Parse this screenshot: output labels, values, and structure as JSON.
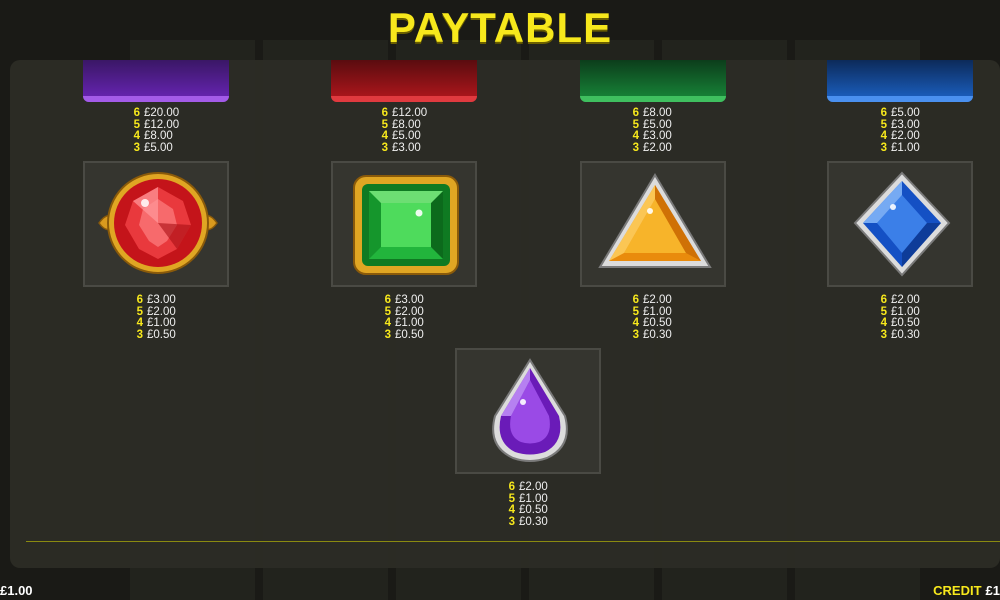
{
  "title": "PAYTABLE",
  "colors": {
    "accent": "#f7e81c",
    "panel": "#2c2d26",
    "text": "#f0f0f0"
  },
  "top_symbols": [
    {
      "name": "purple-card",
      "color": "#7a2bc9",
      "pays": [
        {
          "count": "6",
          "amount": "£20.00"
        },
        {
          "count": "5",
          "amount": "£12.00"
        },
        {
          "count": "4",
          "amount": "£8.00"
        },
        {
          "count": "3",
          "amount": "£5.00"
        }
      ]
    },
    {
      "name": "red-card",
      "color": "#c4161c",
      "pays": [
        {
          "count": "6",
          "amount": "£12.00"
        },
        {
          "count": "5",
          "amount": "£8.00"
        },
        {
          "count": "4",
          "amount": "£5.00"
        },
        {
          "count": "3",
          "amount": "£3.00"
        }
      ]
    },
    {
      "name": "green-card",
      "color": "#1a8a3a",
      "pays": [
        {
          "count": "6",
          "amount": "£8.00"
        },
        {
          "count": "5",
          "amount": "£5.00"
        },
        {
          "count": "4",
          "amount": "£3.00"
        },
        {
          "count": "3",
          "amount": "£2.00"
        }
      ]
    },
    {
      "name": "blue-card",
      "color": "#1c63c7",
      "pays": [
        {
          "count": "6",
          "amount": "£5.00"
        },
        {
          "count": "5",
          "amount": "£3.00"
        },
        {
          "count": "4",
          "amount": "£2.00"
        },
        {
          "count": "3",
          "amount": "£1.00"
        }
      ]
    }
  ],
  "gem_symbols": [
    {
      "name": "red-ruby",
      "icon": "red-round-gem-icon",
      "pays": [
        {
          "count": "6",
          "amount": "£3.00"
        },
        {
          "count": "5",
          "amount": "£2.00"
        },
        {
          "count": "4",
          "amount": "£1.00"
        },
        {
          "count": "3",
          "amount": "£0.50"
        }
      ]
    },
    {
      "name": "green-emerald",
      "icon": "green-square-gem-icon",
      "pays": [
        {
          "count": "6",
          "amount": "£3.00"
        },
        {
          "count": "5",
          "amount": "£2.00"
        },
        {
          "count": "4",
          "amount": "£1.00"
        },
        {
          "count": "3",
          "amount": "£0.50"
        }
      ]
    },
    {
      "name": "orange-triangle",
      "icon": "orange-triangle-gem-icon",
      "pays": [
        {
          "count": "6",
          "amount": "£2.00"
        },
        {
          "count": "5",
          "amount": "£1.00"
        },
        {
          "count": "4",
          "amount": "£0.50"
        },
        {
          "count": "3",
          "amount": "£0.30"
        }
      ]
    },
    {
      "name": "blue-diamond",
      "icon": "blue-diamond-gem-icon",
      "pays": [
        {
          "count": "6",
          "amount": "£2.00"
        },
        {
          "count": "5",
          "amount": "£1.00"
        },
        {
          "count": "4",
          "amount": "£0.50"
        },
        {
          "count": "3",
          "amount": "£0.30"
        }
      ]
    },
    {
      "name": "purple-drop",
      "icon": "purple-drop-gem-icon",
      "pays": [
        {
          "count": "6",
          "amount": "£2.00"
        },
        {
          "count": "5",
          "amount": "£1.00"
        },
        {
          "count": "4",
          "amount": "£0.50"
        },
        {
          "count": "3",
          "amount": "£0.30"
        }
      ]
    }
  ],
  "footer": {
    "bet_value": "£1.00",
    "credit_label": "CREDIT",
    "credit_value": "£1"
  }
}
